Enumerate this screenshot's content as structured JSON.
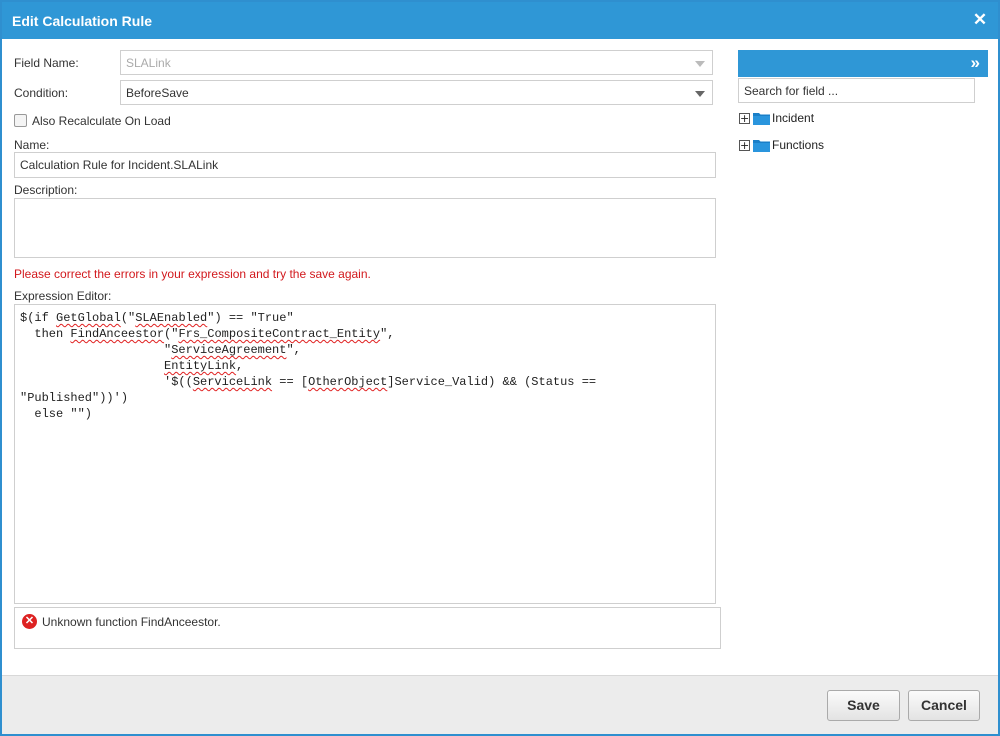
{
  "dialog": {
    "title": "Edit Calculation Rule",
    "close_glyph": "✕"
  },
  "form": {
    "field_name_label": "Field Name:",
    "field_name_value": "SLALink",
    "condition_label": "Condition:",
    "condition_value": "BeforeSave",
    "recalculate_label": "Also Recalculate On Load",
    "recalculate_checked": false,
    "name_label": "Name:",
    "name_value": "Calculation Rule for Incident.SLALink",
    "description_label": "Description:",
    "description_value": "",
    "error_message": "Please correct the errors in your expression and try the save again.",
    "expression_label": "Expression Editor:",
    "expression_text": "$(if GetGlobal(\"SLAEnabled\") == \"True\"\n  then FindAnceestor(\"Frs_CompositeContract_Entity\",\n                    \"ServiceAgreement\",\n                    EntityLink,\n                    '$((ServiceLink == [OtherObject]Service_Valid) && (Status ==\n\"Published\"))')\n  else \"\")",
    "validation_message": "Unknown function FindAnceestor."
  },
  "side_panel": {
    "expand_glyph": "»",
    "search_placeholder": "Search for field ...",
    "tree": [
      {
        "label": "Incident",
        "icon": "folder-icon"
      },
      {
        "label": "Functions",
        "icon": "folder-icon"
      }
    ]
  },
  "footer": {
    "save_label": "Save",
    "cancel_label": "Cancel"
  },
  "colors": {
    "accent": "#2f97d6",
    "error": "#d2191d",
    "folder": "#1a7fc8"
  }
}
